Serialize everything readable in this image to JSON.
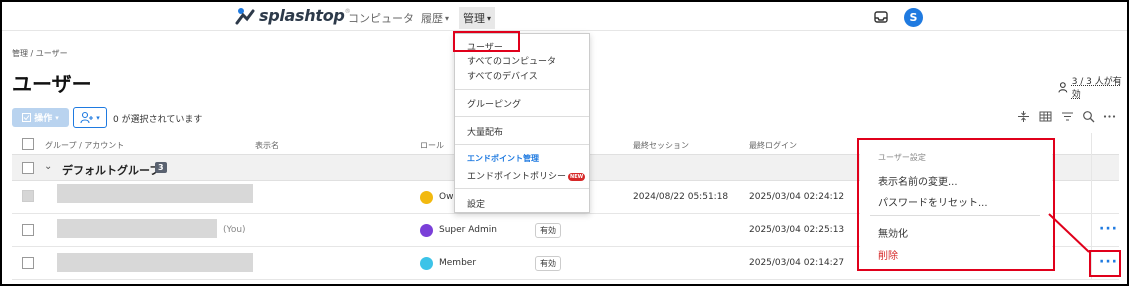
{
  "nav": {
    "brand": "splashtop",
    "items": [
      {
        "label": "コンピュータ"
      },
      {
        "label": "履歴",
        "caret": "▾"
      },
      {
        "label": "管理",
        "caret": "▾"
      }
    ],
    "avatar_initial": "S"
  },
  "breadcrumb": "管理  /  ユーザー",
  "page_title": "ユーザー",
  "licenses": "3 / 3 人が有効",
  "toolbar": {
    "operations_label": "操作",
    "selected_text": "0 が選択されています"
  },
  "table": {
    "headers": {
      "group_account": "グループ / アカウント",
      "display_name": "表示名",
      "role": "ロール",
      "last_session": "最終セッション",
      "last_login": "最終ログイン"
    },
    "group": {
      "name": "デフォルトグループ",
      "count": "3"
    },
    "rows": [
      {
        "you": "",
        "role": "Ow",
        "role_color": "#f2b90f",
        "status": "",
        "last_session": "2024/08/22 05:51:18",
        "last_login": "2025/03/04 02:24:12",
        "more": ""
      },
      {
        "you": "(You)",
        "role": "Super Admin",
        "role_color": "#7a3fd8",
        "status": "有効",
        "last_session": "",
        "last_login": "2025/03/04 02:25:13",
        "more": "···"
      },
      {
        "you": "",
        "role": "Member",
        "role_color": "#3cc3e8",
        "status": "有効",
        "last_session": "",
        "last_login": "2025/03/04 02:14:27",
        "more": "···"
      }
    ]
  },
  "admin_menu": {
    "items": [
      "ユーザー",
      "すべてのコンピュータ",
      "すべてのデバイス",
      "グルーピング",
      "大量配布"
    ],
    "endpoint_section": "エンドポイント管理",
    "endpoint_policy": "エンドポイントポリシー",
    "new_badge": "NEW",
    "settings": "設定"
  },
  "context_menu": {
    "title": "ユーザー設定",
    "rename": "表示名前の変更...",
    "reset_password": "パスワードをリセット...",
    "disable": "無効化",
    "delete": "削除"
  },
  "colors": {
    "accent": "#1f7ae0",
    "annotation": "#e0001b",
    "danger": "#d62828"
  }
}
